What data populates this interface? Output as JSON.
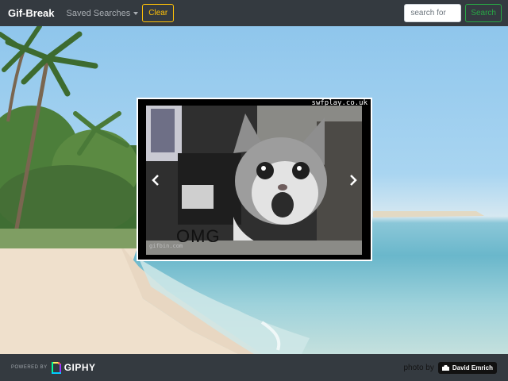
{
  "navbar": {
    "brand": "Gif-Break",
    "saved_searches": "Saved Searches",
    "clear_label": "Clear",
    "search_placeholder": "search for",
    "search_label": "Search"
  },
  "carousel": {
    "watermark": "swfplay.co.uk",
    "caption": "OMG",
    "source_mark": "gifbin.com",
    "prev_icon": "chevron-left-icon",
    "next_icon": "chevron-right-icon"
  },
  "footer": {
    "powered_by": "POWERED BY",
    "giphy": "GIPHY",
    "photo_by": "photo by",
    "author": "David Emrich"
  },
  "colors": {
    "navbar_bg": "#343a40",
    "clear_accent": "#ffc107",
    "search_accent": "#28a745"
  }
}
